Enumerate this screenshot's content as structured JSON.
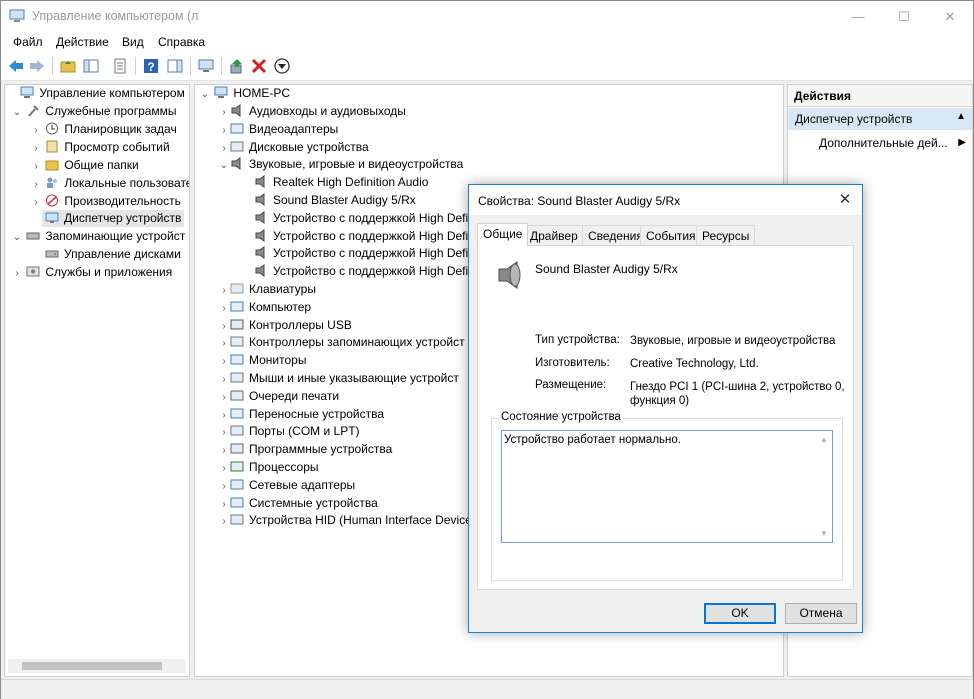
{
  "window": {
    "title": "Управление компьютером (л",
    "caption": {
      "min": "—",
      "max": "☐",
      "close": "✕"
    }
  },
  "menu": [
    "Файл",
    "Действие",
    "Вид",
    "Справка"
  ],
  "left_tree": [
    {
      "label": "Управление компьютером (л",
      "icon": "computer-management-icon",
      "expander": ""
    },
    {
      "label": "Служебные программы",
      "icon": "tools-icon",
      "expander": "⌄"
    },
    {
      "label": "Планировщик задач",
      "icon": "clock-icon",
      "expander": "›"
    },
    {
      "label": "Просмотр событий",
      "icon": "event-viewer-icon",
      "expander": "›"
    },
    {
      "label": "Общие папки",
      "icon": "shared-folder-icon",
      "expander": "›"
    },
    {
      "label": "Локальные пользовате",
      "icon": "users-icon",
      "expander": "›"
    },
    {
      "label": "Производительность",
      "icon": "performance-icon",
      "expander": "›"
    },
    {
      "label": "Диспетчер устройств",
      "icon": "device-manager-icon",
      "expander": ""
    },
    {
      "label": "Запоминающие устройст",
      "icon": "storage-icon",
      "expander": "⌄"
    },
    {
      "label": "Управление дисками",
      "icon": "disk-management-icon",
      "expander": ""
    },
    {
      "label": "Службы и приложения",
      "icon": "services-icon",
      "expander": "›"
    }
  ],
  "device_tree": {
    "root": "HOME-PC",
    "items": [
      {
        "label": "Аудиовходы и аудиовыходы",
        "icon": "audio-io-icon",
        "expander": "›"
      },
      {
        "label": "Видеоадаптеры",
        "icon": "display-adapter-icon",
        "expander": "›"
      },
      {
        "label": "Дисковые устройства",
        "icon": "disk-drive-icon",
        "expander": "›"
      },
      {
        "label": "Звуковые, игровые и видеоустройства",
        "icon": "speaker-icon",
        "expander": "⌄"
      },
      {
        "label": "Realtek High Definition Audio",
        "icon": "speaker-icon",
        "expander": ""
      },
      {
        "label": "Sound Blaster Audigy 5/Rx",
        "icon": "speaker-icon",
        "expander": ""
      },
      {
        "label": "Устройство с поддержкой High Defi",
        "icon": "speaker-icon",
        "expander": ""
      },
      {
        "label": "Устройство с поддержкой High Defi",
        "icon": "speaker-icon",
        "expander": ""
      },
      {
        "label": "Устройство с поддержкой High Defi",
        "icon": "speaker-icon",
        "expander": ""
      },
      {
        "label": "Устройство с поддержкой High Defi",
        "icon": "speaker-icon",
        "expander": ""
      },
      {
        "label": "Клавиатуры",
        "icon": "keyboard-icon",
        "expander": "›"
      },
      {
        "label": "Компьютер",
        "icon": "computer-icon",
        "expander": "›"
      },
      {
        "label": "Контроллеры USB",
        "icon": "usb-icon",
        "expander": "›"
      },
      {
        "label": "Контроллеры запоминающих устройст",
        "icon": "storage-controller-icon",
        "expander": "›"
      },
      {
        "label": "Мониторы",
        "icon": "monitor-icon",
        "expander": "›"
      },
      {
        "label": "Мыши и иные указывающие устройст",
        "icon": "mouse-icon",
        "expander": "›"
      },
      {
        "label": "Очереди печати",
        "icon": "printer-icon",
        "expander": "›"
      },
      {
        "label": "Переносные устройства",
        "icon": "portable-device-icon",
        "expander": "›"
      },
      {
        "label": "Порты (COM и LPT)",
        "icon": "port-icon",
        "expander": "›"
      },
      {
        "label": "Программные устройства",
        "icon": "software-device-icon",
        "expander": "›"
      },
      {
        "label": "Процессоры",
        "icon": "processor-icon",
        "expander": "›"
      },
      {
        "label": "Сетевые адаптеры",
        "icon": "network-adapter-icon",
        "expander": "›"
      },
      {
        "label": "Системные устройства",
        "icon": "system-device-icon",
        "expander": "›"
      },
      {
        "label": "Устройства HID (Human Interface Device",
        "icon": "hid-icon",
        "expander": "›"
      }
    ]
  },
  "actions": {
    "header": "Действия",
    "selected": "Диспетчер устройств",
    "more": "Дополнительные дей..."
  },
  "dialog": {
    "title": "Свойства: Sound Blaster Audigy 5/Rx",
    "tabs": [
      "Общие",
      "Драйвер",
      "Сведения",
      "События",
      "Ресурсы"
    ],
    "active_tab": "Общие",
    "device_name": "Sound Blaster Audigy 5/Rx",
    "properties": [
      {
        "label": "Тип устройства:",
        "value": "Звуковые, игровые и видеоустройства"
      },
      {
        "label": "Изготовитель:",
        "value": "Creative Technology, Ltd."
      },
      {
        "label": "Размещение:",
        "value": "Гнездо PCI 1 (PCI-шина 2, устройство 0, функция 0)"
      }
    ],
    "status_group": "Состояние устройства",
    "status_text": "Устройство работает нормально.",
    "ok": "OK",
    "cancel": "Отмена"
  },
  "colors": {
    "accent": "#0078d7",
    "selection": "#d9e6f5"
  }
}
